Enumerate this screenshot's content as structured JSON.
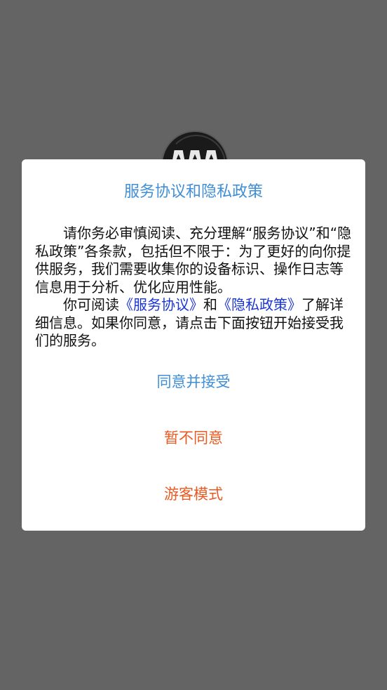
{
  "dialog": {
    "title": "服务协议和隐私政策",
    "paragraph1": "请你务必审慎阅读、充分理解“服务协议”和“隐私政策”各条款，包括但不限于：为了更好的向你提供服务，我们需要收集你的设备标识、操作日志等信息用于分析、优化应用性能。",
    "p2_prefix": "你可阅读",
    "p2_link_service": "《服务协议》",
    "p2_and": "和",
    "p2_link_privacy": "《隐私政策》",
    "p2_suffix": "了解详细信息。如果你同意，请点击下面按钮开始接受我们的服务。",
    "agree_label": "同意并接受",
    "disagree_label": "暂不同意",
    "guest_label": "游客模式"
  },
  "background": {
    "logo_icon": "app-logo-icon"
  },
  "colors": {
    "title": "#3f8ed6",
    "agree": "#3f8ed6",
    "decline": "#e85a22",
    "link": "#1a35d6",
    "overlay": "#646464"
  }
}
